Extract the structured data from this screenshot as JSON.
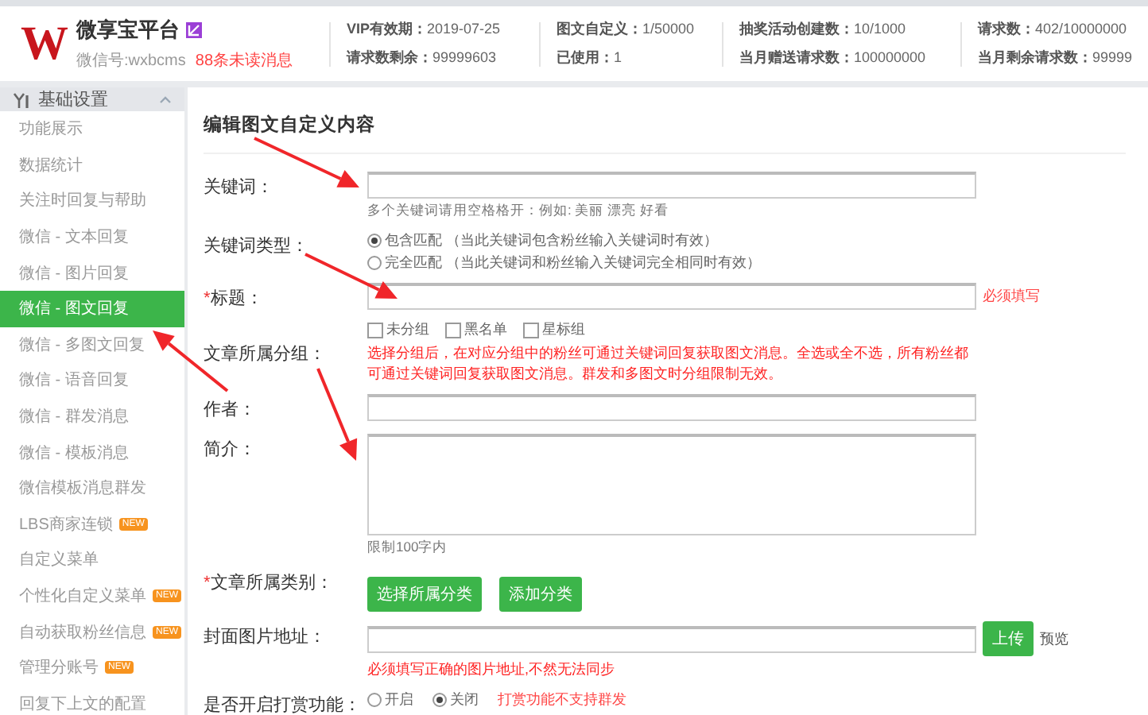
{
  "header": {
    "logo_letter": "W",
    "brand": "微享宝平台",
    "account": "微信号:wxbcms",
    "unread": "88条未读消息",
    "stat_columns": [
      [
        {
          "label": "VIP有效期：",
          "value": "2019-07-25"
        },
        {
          "label": "请求数剩余：",
          "value": "99999603"
        }
      ],
      [
        {
          "label": "图文自定义：",
          "value": "1/50000"
        },
        {
          "label": "已使用：",
          "value": "1"
        }
      ],
      [
        {
          "label": "抽奖活动创建数：",
          "value": "10/1000"
        },
        {
          "label": "当月赠送请求数：",
          "value": "100000000"
        }
      ],
      [
        {
          "label": "请求数：",
          "value": "402/10000000"
        },
        {
          "label": "当月剩余请求数：",
          "value": "99999"
        }
      ]
    ]
  },
  "sidebar": {
    "group": {
      "title": "基础设置",
      "expanded": true
    },
    "items": [
      {
        "label": "功能展示",
        "selected": false
      },
      {
        "label": "数据统计",
        "selected": false
      },
      {
        "label": "关注时回复与帮助",
        "selected": false
      },
      {
        "label": "微信 - 文本回复",
        "selected": false
      },
      {
        "label": "微信 - 图片回复",
        "selected": false
      },
      {
        "label": "微信 - 图文回复",
        "selected": true
      },
      {
        "label": "微信 - 多图文回复",
        "selected": false
      },
      {
        "label": "微信 - 语音回复",
        "selected": false
      },
      {
        "label": "微信 - 群发消息",
        "selected": false
      },
      {
        "label": "微信 - 模板消息",
        "selected": false
      },
      {
        "label": "微信模板消息群发",
        "selected": false
      },
      {
        "label": "LBS商家连锁",
        "selected": false,
        "badge": "NEW"
      },
      {
        "label": "自定义菜单",
        "selected": false
      },
      {
        "label": "个性化自定义菜单",
        "selected": false,
        "badge": "NEW"
      },
      {
        "label": "自动获取粉丝信息",
        "selected": false,
        "badge": "NEW"
      },
      {
        "label": "管理分账号",
        "selected": false,
        "badge": "NEW"
      },
      {
        "label": "回复下上文的配置",
        "selected": false
      }
    ]
  },
  "form": {
    "title": "编辑图文自定义内容",
    "rows": [
      {
        "kind": "text",
        "label": "关键词：",
        "note": "多个关键词请用空格格开：例如: 美丽 漂亮 好看"
      },
      {
        "kind": "radio",
        "label": "关键词类型：",
        "options": [
          {
            "label": "包含匹配",
            "note": "（当此关键词包含粉丝输入关键词时有效）",
            "selected": true
          },
          {
            "label": "完全匹配",
            "note": "（当此关键词和粉丝输入关键词完全相同时有效）",
            "selected": false
          }
        ]
      },
      {
        "kind": "text",
        "required_mark": "*",
        "label": "标题：",
        "side_warning": "必须填写"
      },
      {
        "kind": "checkbox",
        "label": "文章所属分组：",
        "options": [
          {
            "label": "未分组",
            "checked": false
          },
          {
            "label": "黑名单",
            "checked": false
          },
          {
            "label": "星标组",
            "checked": false
          }
        ],
        "warning": "选择分组后，在对应分组中的粉丝可通过关键词回复获取图文消息。全选或全不选，所有粉丝都可通过关键词回复获取图文消息。群发和多图文时分组限制无效。"
      },
      {
        "kind": "text",
        "label": "作者："
      },
      {
        "kind": "textarea",
        "label": "简介：",
        "note": "限制100字内"
      },
      {
        "kind": "buttons",
        "required_mark": "*",
        "label": "文章所属类别：",
        "buttons": [
          "选择所属分类",
          "添加分类"
        ]
      },
      {
        "kind": "upload",
        "label": "封面图片地址：",
        "button": "上传",
        "link": "预览",
        "warning": "必须填写正确的图片地址,不然无法同步"
      },
      {
        "kind": "radio",
        "label": "是否开启打赏功能：",
        "options": [
          {
            "label": "开启",
            "selected": false
          },
          {
            "label": "关闭",
            "selected": true
          }
        ],
        "side_warning": "打赏功能不支持群发"
      }
    ]
  }
}
